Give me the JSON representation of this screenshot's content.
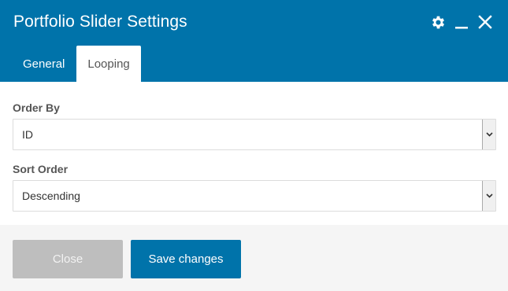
{
  "dialog": {
    "title": "Portfolio Slider Settings"
  },
  "header_icons": [
    "gear-icon",
    "minimize-icon",
    "close-icon"
  ],
  "tabs": [
    {
      "label": "General",
      "active": false
    },
    {
      "label": "Looping",
      "active": true
    }
  ],
  "fields": {
    "order_by": {
      "label": "Order By",
      "value": "ID"
    },
    "sort_order": {
      "label": "Sort Order",
      "value": "Descending"
    }
  },
  "footer": {
    "close_label": "Close",
    "save_label": "Save changes"
  },
  "colors": {
    "header": "#0073aa",
    "save_button": "#0073aa",
    "close_button": "#bebebe",
    "footer_bg": "#f5f5f5"
  }
}
